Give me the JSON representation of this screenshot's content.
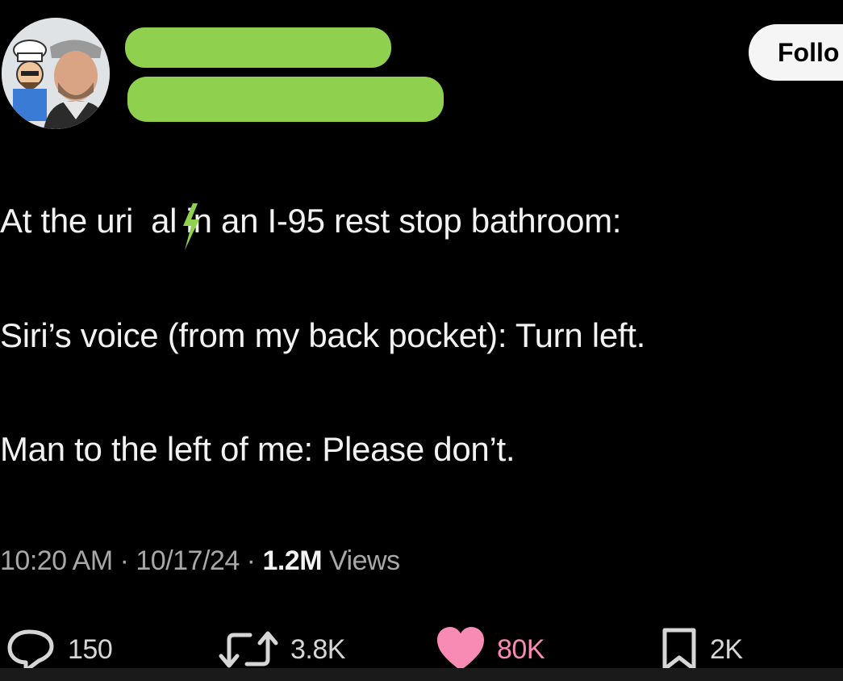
{
  "header": {
    "follow_label": "Follo"
  },
  "tweet": {
    "line1_before": "At the uri",
    "line1_after": "al in an I-95 rest stop bathroom:",
    "line2": "Siri’s voice (from my back pocket): Turn left.",
    "line3": "Man to the left of me: Please don’t."
  },
  "meta": {
    "time": "10:20 AM",
    "sep1": " · ",
    "date": "10/17/24",
    "sep2": " · ",
    "views_count": "1.2M",
    "views_label": " Views"
  },
  "actions": {
    "replies": "150",
    "reposts": "3.8K",
    "likes": "80K",
    "bookmarks": "2K"
  },
  "colors": {
    "redaction": "#8fd14f",
    "like": "#f78bb4",
    "background": "#000000"
  }
}
